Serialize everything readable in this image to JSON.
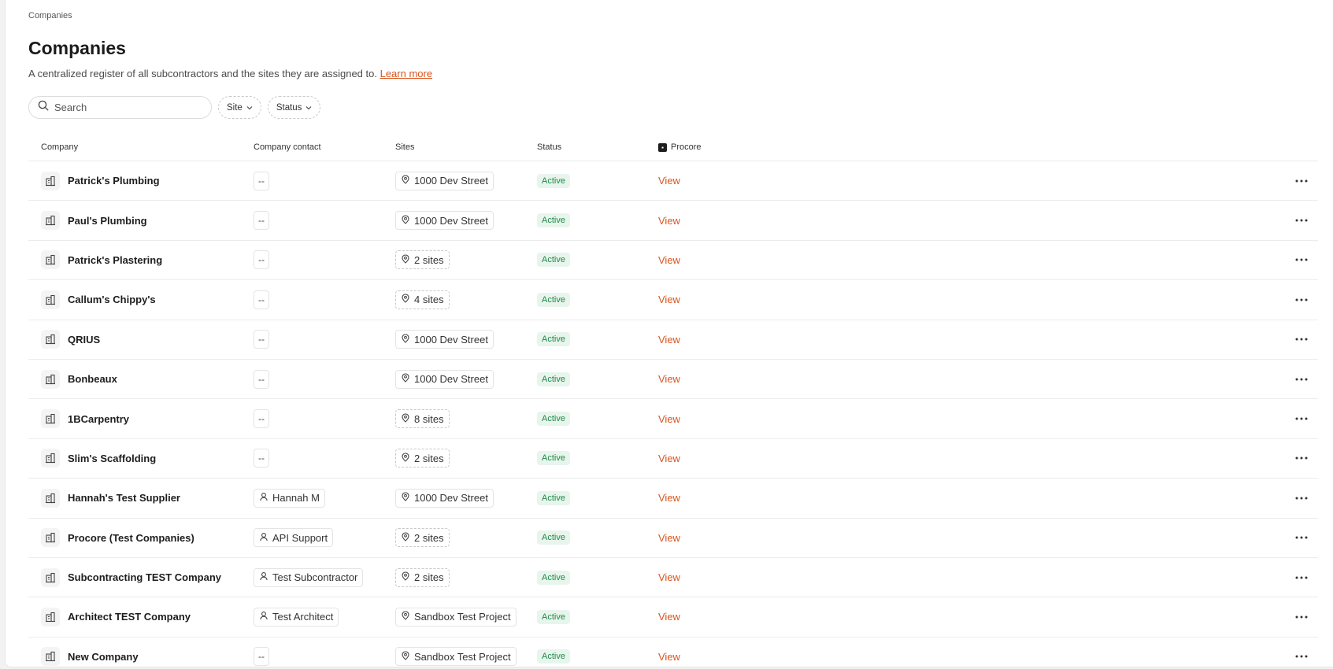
{
  "breadcrumb": "Companies",
  "page": {
    "title": "Companies",
    "description": "A centralized register of all subcontractors and the sites they are assigned to.",
    "learn_more": "Learn more"
  },
  "search": {
    "placeholder": "Search",
    "value": ""
  },
  "filters": {
    "site": "Site",
    "status": "Status"
  },
  "columns": {
    "company": "Company",
    "contact": "Company contact",
    "sites": "Sites",
    "status": "Status",
    "procore": "Procore"
  },
  "rows": [
    {
      "company": "Patrick's Plumbing",
      "contact": "--",
      "contact_type": "empty",
      "sites": "1000 Dev Street",
      "sites_type": "single",
      "status": "Active",
      "procore": "View"
    },
    {
      "company": "Paul's Plumbing",
      "contact": "--",
      "contact_type": "empty",
      "sites": "1000 Dev Street",
      "sites_type": "single",
      "status": "Active",
      "procore": "View"
    },
    {
      "company": "Patrick's Plastering",
      "contact": "--",
      "contact_type": "empty",
      "sites": "2 sites",
      "sites_type": "multi",
      "status": "Active",
      "procore": "View"
    },
    {
      "company": "Callum's Chippy's",
      "contact": "--",
      "contact_type": "empty",
      "sites": "4 sites",
      "sites_type": "multi",
      "status": "Active",
      "procore": "View"
    },
    {
      "company": "QRIUS",
      "contact": "--",
      "contact_type": "empty",
      "sites": "1000 Dev Street",
      "sites_type": "single",
      "status": "Active",
      "procore": "View"
    },
    {
      "company": "Bonbeaux",
      "contact": "--",
      "contact_type": "empty",
      "sites": "1000 Dev Street",
      "sites_type": "single",
      "status": "Active",
      "procore": "View"
    },
    {
      "company": "1BCarpentry",
      "contact": "--",
      "contact_type": "empty",
      "sites": "8 sites",
      "sites_type": "multi",
      "status": "Active",
      "procore": "View"
    },
    {
      "company": "Slim's Scaffolding",
      "contact": "--",
      "contact_type": "empty",
      "sites": "2 sites",
      "sites_type": "multi",
      "status": "Active",
      "procore": "View"
    },
    {
      "company": "Hannah's Test Supplier",
      "contact": "Hannah M",
      "contact_type": "person",
      "sites": "1000 Dev Street",
      "sites_type": "single",
      "status": "Active",
      "procore": "View"
    },
    {
      "company": "Procore (Test Companies)",
      "contact": "API Support",
      "contact_type": "person",
      "sites": "2 sites",
      "sites_type": "multi",
      "status": "Active",
      "procore": "View"
    },
    {
      "company": "Subcontracting TEST Company",
      "contact": "Test Subcontractor",
      "contact_type": "person",
      "sites": "2 sites",
      "sites_type": "multi",
      "status": "Active",
      "procore": "View"
    },
    {
      "company": "Architect TEST Company",
      "contact": "Test Architect",
      "contact_type": "person",
      "sites": "Sandbox Test Project",
      "sites_type": "single",
      "status": "Active",
      "procore": "View"
    },
    {
      "company": "New Company",
      "contact": "--",
      "contact_type": "empty",
      "sites": "Sandbox Test Project",
      "sites_type": "single",
      "status": "Active",
      "procore": "View"
    }
  ],
  "colors": {
    "accent": "#d9541e",
    "active_text": "#1e8a4a",
    "active_bg": "#e8f5ec"
  }
}
